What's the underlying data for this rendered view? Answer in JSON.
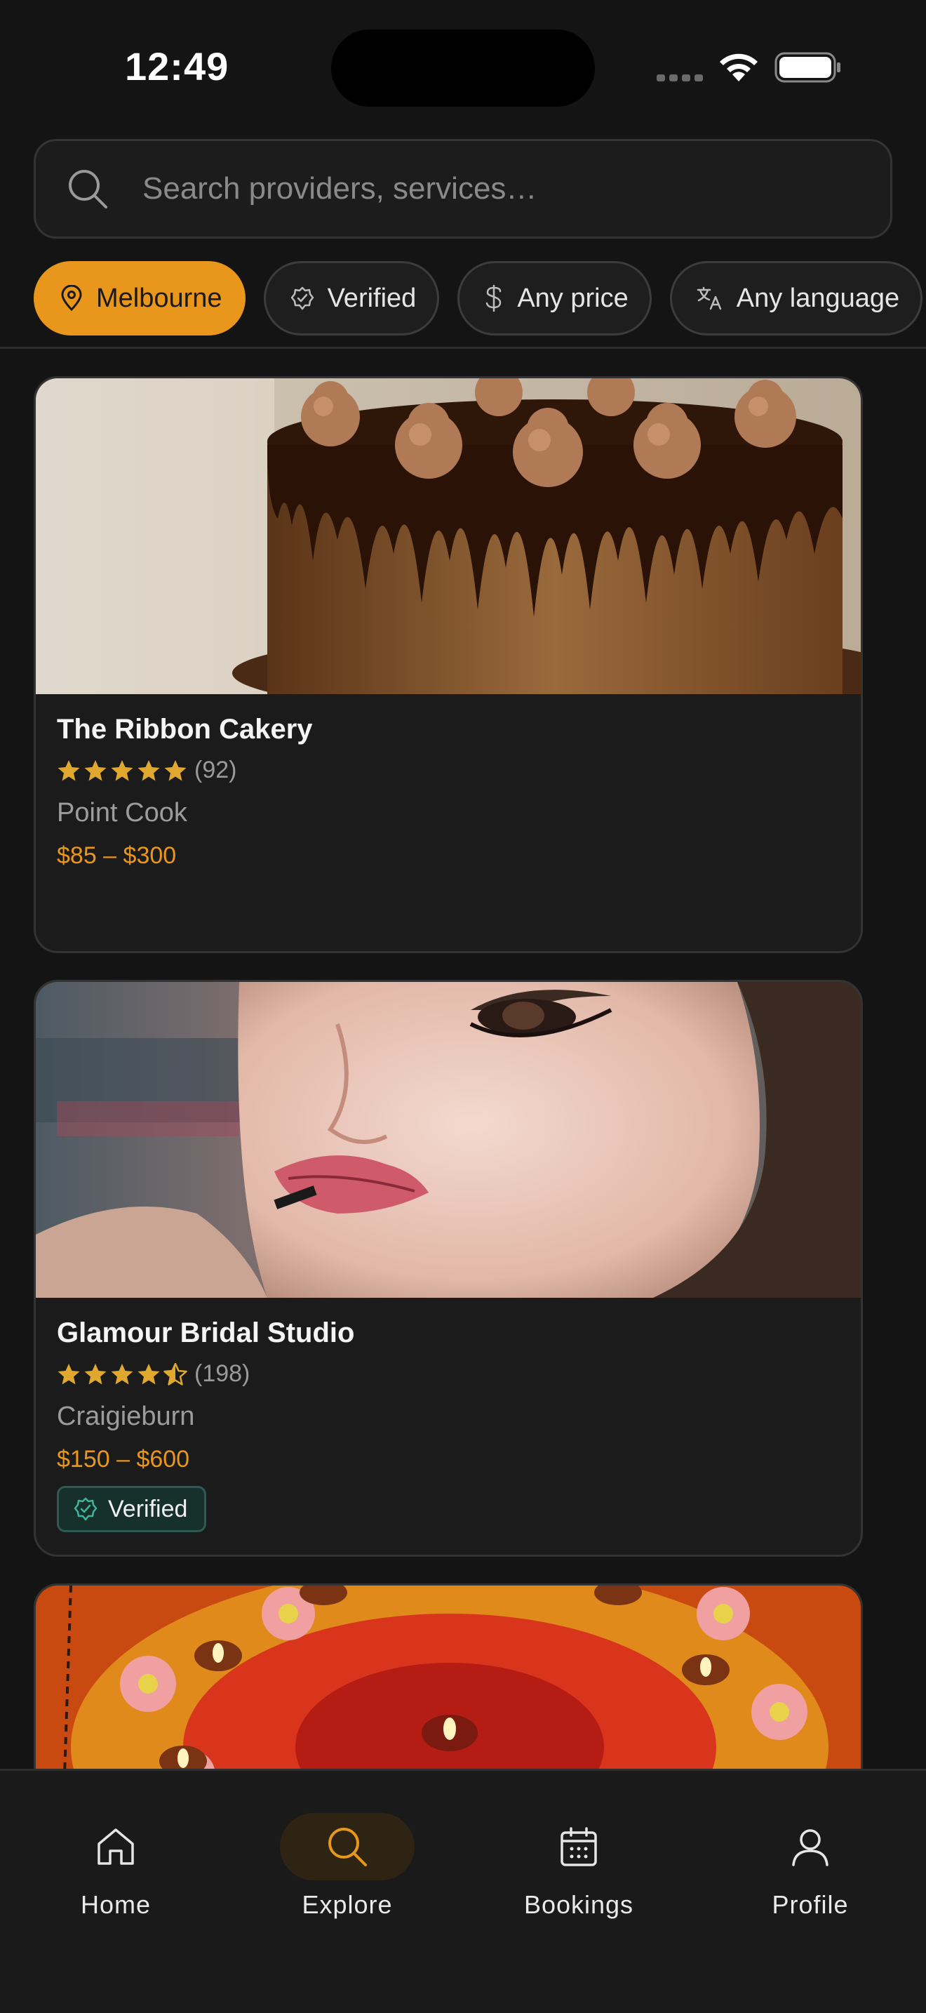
{
  "status_bar": {
    "time": "12:49"
  },
  "search": {
    "placeholder": "Search providers, services…"
  },
  "filters": [
    {
      "label": "Melbourne",
      "icon": "location-pin-icon",
      "active": true
    },
    {
      "label": "Verified",
      "icon": "verified-badge-icon",
      "active": false
    },
    {
      "label": "Any price",
      "icon": "dollar-icon",
      "active": false
    },
    {
      "label": "Any language",
      "icon": "translate-icon",
      "active": false
    }
  ],
  "listings": [
    {
      "name": "The Ribbon Cakery",
      "rating": 5.0,
      "review_count": "(92)",
      "location": "Point Cook",
      "price": "$85 – $300",
      "verified": false,
      "image": "chocolate drip cake"
    },
    {
      "name": "Glamour Bridal Studio",
      "rating": 4.5,
      "review_count": "(198)",
      "location": "Craigieburn",
      "price": "$150 – $600",
      "verified": true,
      "verified_label": "Verified",
      "image": "bridal makeup lipstick application"
    },
    {
      "image": "floral rangoli with diya lamps"
    }
  ],
  "nav": [
    {
      "label": "Home",
      "icon": "home-icon",
      "active": false
    },
    {
      "label": "Explore",
      "icon": "search-icon",
      "active": true
    },
    {
      "label": "Bookings",
      "icon": "calendar-icon",
      "active": false
    },
    {
      "label": "Profile",
      "icon": "user-icon",
      "active": false
    }
  ],
  "colors": {
    "accent": "#e8961c",
    "background": "#141414",
    "card": "#1b1b1b",
    "verified_bg": "#16302c",
    "star": "#e0a82e"
  }
}
